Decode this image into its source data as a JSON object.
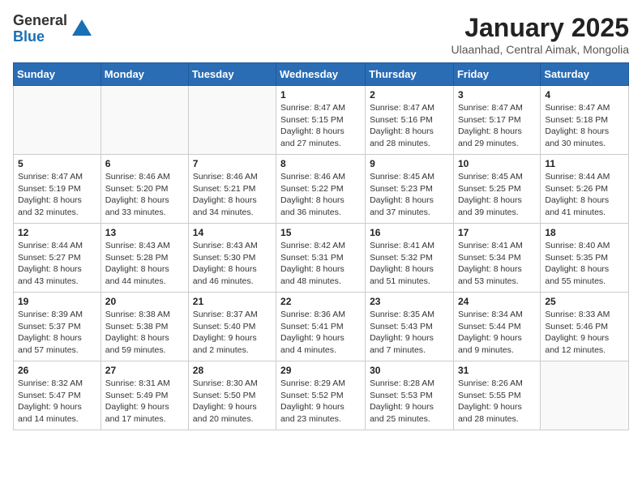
{
  "header": {
    "logo_general": "General",
    "logo_blue": "Blue",
    "month_title": "January 2025",
    "location": "Ulaanhad, Central Aimak, Mongolia"
  },
  "days_of_week": [
    "Sunday",
    "Monday",
    "Tuesday",
    "Wednesday",
    "Thursday",
    "Friday",
    "Saturday"
  ],
  "weeks": [
    [
      {
        "day": "",
        "info": ""
      },
      {
        "day": "",
        "info": ""
      },
      {
        "day": "",
        "info": ""
      },
      {
        "day": "1",
        "info": "Sunrise: 8:47 AM\nSunset: 5:15 PM\nDaylight: 8 hours\nand 27 minutes."
      },
      {
        "day": "2",
        "info": "Sunrise: 8:47 AM\nSunset: 5:16 PM\nDaylight: 8 hours\nand 28 minutes."
      },
      {
        "day": "3",
        "info": "Sunrise: 8:47 AM\nSunset: 5:17 PM\nDaylight: 8 hours\nand 29 minutes."
      },
      {
        "day": "4",
        "info": "Sunrise: 8:47 AM\nSunset: 5:18 PM\nDaylight: 8 hours\nand 30 minutes."
      }
    ],
    [
      {
        "day": "5",
        "info": "Sunrise: 8:47 AM\nSunset: 5:19 PM\nDaylight: 8 hours\nand 32 minutes."
      },
      {
        "day": "6",
        "info": "Sunrise: 8:46 AM\nSunset: 5:20 PM\nDaylight: 8 hours\nand 33 minutes."
      },
      {
        "day": "7",
        "info": "Sunrise: 8:46 AM\nSunset: 5:21 PM\nDaylight: 8 hours\nand 34 minutes."
      },
      {
        "day": "8",
        "info": "Sunrise: 8:46 AM\nSunset: 5:22 PM\nDaylight: 8 hours\nand 36 minutes."
      },
      {
        "day": "9",
        "info": "Sunrise: 8:45 AM\nSunset: 5:23 PM\nDaylight: 8 hours\nand 37 minutes."
      },
      {
        "day": "10",
        "info": "Sunrise: 8:45 AM\nSunset: 5:25 PM\nDaylight: 8 hours\nand 39 minutes."
      },
      {
        "day": "11",
        "info": "Sunrise: 8:44 AM\nSunset: 5:26 PM\nDaylight: 8 hours\nand 41 minutes."
      }
    ],
    [
      {
        "day": "12",
        "info": "Sunrise: 8:44 AM\nSunset: 5:27 PM\nDaylight: 8 hours\nand 43 minutes."
      },
      {
        "day": "13",
        "info": "Sunrise: 8:43 AM\nSunset: 5:28 PM\nDaylight: 8 hours\nand 44 minutes."
      },
      {
        "day": "14",
        "info": "Sunrise: 8:43 AM\nSunset: 5:30 PM\nDaylight: 8 hours\nand 46 minutes."
      },
      {
        "day": "15",
        "info": "Sunrise: 8:42 AM\nSunset: 5:31 PM\nDaylight: 8 hours\nand 48 minutes."
      },
      {
        "day": "16",
        "info": "Sunrise: 8:41 AM\nSunset: 5:32 PM\nDaylight: 8 hours\nand 51 minutes."
      },
      {
        "day": "17",
        "info": "Sunrise: 8:41 AM\nSunset: 5:34 PM\nDaylight: 8 hours\nand 53 minutes."
      },
      {
        "day": "18",
        "info": "Sunrise: 8:40 AM\nSunset: 5:35 PM\nDaylight: 8 hours\nand 55 minutes."
      }
    ],
    [
      {
        "day": "19",
        "info": "Sunrise: 8:39 AM\nSunset: 5:37 PM\nDaylight: 8 hours\nand 57 minutes."
      },
      {
        "day": "20",
        "info": "Sunrise: 8:38 AM\nSunset: 5:38 PM\nDaylight: 8 hours\nand 59 minutes."
      },
      {
        "day": "21",
        "info": "Sunrise: 8:37 AM\nSunset: 5:40 PM\nDaylight: 9 hours\nand 2 minutes."
      },
      {
        "day": "22",
        "info": "Sunrise: 8:36 AM\nSunset: 5:41 PM\nDaylight: 9 hours\nand 4 minutes."
      },
      {
        "day": "23",
        "info": "Sunrise: 8:35 AM\nSunset: 5:43 PM\nDaylight: 9 hours\nand 7 minutes."
      },
      {
        "day": "24",
        "info": "Sunrise: 8:34 AM\nSunset: 5:44 PM\nDaylight: 9 hours\nand 9 minutes."
      },
      {
        "day": "25",
        "info": "Sunrise: 8:33 AM\nSunset: 5:46 PM\nDaylight: 9 hours\nand 12 minutes."
      }
    ],
    [
      {
        "day": "26",
        "info": "Sunrise: 8:32 AM\nSunset: 5:47 PM\nDaylight: 9 hours\nand 14 minutes."
      },
      {
        "day": "27",
        "info": "Sunrise: 8:31 AM\nSunset: 5:49 PM\nDaylight: 9 hours\nand 17 minutes."
      },
      {
        "day": "28",
        "info": "Sunrise: 8:30 AM\nSunset: 5:50 PM\nDaylight: 9 hours\nand 20 minutes."
      },
      {
        "day": "29",
        "info": "Sunrise: 8:29 AM\nSunset: 5:52 PM\nDaylight: 9 hours\nand 23 minutes."
      },
      {
        "day": "30",
        "info": "Sunrise: 8:28 AM\nSunset: 5:53 PM\nDaylight: 9 hours\nand 25 minutes."
      },
      {
        "day": "31",
        "info": "Sunrise: 8:26 AM\nSunset: 5:55 PM\nDaylight: 9 hours\nand 28 minutes."
      },
      {
        "day": "",
        "info": ""
      }
    ]
  ]
}
